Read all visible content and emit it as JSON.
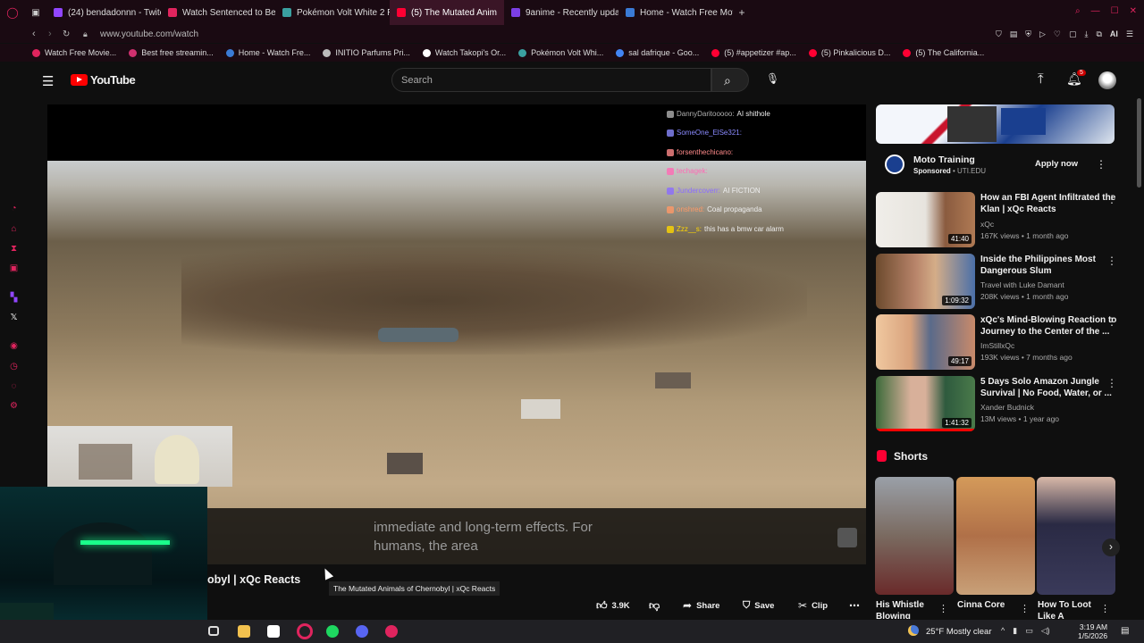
{
  "browser": {
    "tabs": [
      {
        "label": "(24) bendadonnn - Twitch",
        "color": "#9146ff",
        "active": false
      },
      {
        "label": "Watch Sentenced to Be a",
        "color": "#e0245e",
        "active": false
      },
      {
        "label": "Pokémon Volt White 2 Re",
        "color": "#3aa0a0",
        "active": false
      },
      {
        "label": "(5) The Mutated Anim",
        "color": "#ff0033",
        "active": true
      },
      {
        "label": "9anime - Recently update",
        "color": "#7b3fe4",
        "active": false
      },
      {
        "label": "Home - Watch Free Movie",
        "color": "#3a7bd5",
        "active": false
      }
    ],
    "new_tab_symbol": "+",
    "url": "www.youtube.com/watch",
    "bookmarks": [
      {
        "label": "Watch Free Movie...",
        "color": "#e0245e"
      },
      {
        "label": "Best free streamin...",
        "color": "#d0306f"
      },
      {
        "label": "Home - Watch Fre...",
        "color": "#3a7bd5"
      },
      {
        "label": "INITIO Parfums Pri...",
        "color": "#bbbbbb"
      },
      {
        "label": "Watch Takopi's Or...",
        "color": "#ffffff"
      },
      {
        "label": "Pokémon Volt Whi...",
        "color": "#3aa0a0"
      },
      {
        "label": "sal dafrique - Goo...",
        "color": "#4285f4"
      },
      {
        "label": "(5) #appetizer #ap...",
        "color": "#ff0033"
      },
      {
        "label": "(5) Pinkalicious D...",
        "color": "#ff0033"
      },
      {
        "label": "(5) The California...",
        "color": "#ff0033"
      }
    ]
  },
  "youtube": {
    "logo_text": "YouTube",
    "search_placeholder": "Search",
    "notification_count": "5"
  },
  "video": {
    "caption_line1": "immediate and long-term effects. For",
    "caption_line2": "humans, the area",
    "title_partial": "obyl | xQc Reacts",
    "tooltip": "The Mutated Animals of Chernobyl | xQc Reacts",
    "likes": "3.9K",
    "share_label": "Share",
    "save_label": "Save",
    "clip_label": "Clip"
  },
  "chat": [
    {
      "user": "DannyDaritooooo:",
      "msg": "AI shithole",
      "color": "#b0b0b0"
    },
    {
      "user": "SomeOne_ElSe321:",
      "msg": "",
      "color": "#8a8aff"
    },
    {
      "user": "forsenthechicano:",
      "msg": "",
      "color": "#ff8a8a"
    },
    {
      "user": "techagek:",
      "msg": "",
      "color": "#ff69b4"
    },
    {
      "user": "Jundercoverr:",
      "msg": "AI FICTION",
      "color": "#8a6bff"
    },
    {
      "user": "onshred:",
      "msg": "Coal propaganda",
      "color": "#ff9966"
    },
    {
      "user": "Zzz__s:",
      "msg": "this has a bmw car alarm",
      "color": "#ffd700"
    }
  ],
  "ad": {
    "title": "Moto Training",
    "sponsored": "Sponsored",
    "domain": "UTI.EDU",
    "cta": "Apply now"
  },
  "recommendations": [
    {
      "title1": "How an FBI Agent Infiltrated the",
      "title2": "Klan | xQc Reacts",
      "channel": "xQc",
      "meta": "167K views • 1 month ago",
      "duration": "41:40"
    },
    {
      "title1": "Inside the Philippines Most",
      "title2": "Dangerous Slum",
      "channel": "Travel with Luke Damant",
      "meta": "208K views • 1 month ago",
      "duration": "1:09:32"
    },
    {
      "title1": "xQc's Mind-Blowing Reaction to",
      "title2": "Journey to the Center of the ...",
      "channel": "ImStillxQc",
      "meta": "193K views • 7 months ago",
      "duration": "49:17"
    },
    {
      "title1": "5 Days Solo Amazon Jungle",
      "title2": "Survival | No Food, Water, or ...",
      "channel": "Xander Budnick",
      "meta": "13M views • 1 year ago",
      "duration": "1:41:32"
    }
  ],
  "shorts": {
    "heading": "Shorts",
    "items": [
      {
        "title": "His Whistle Blowing"
      },
      {
        "title": "Cinna Core"
      },
      {
        "title": "How To Loot Like A"
      }
    ]
  },
  "taskbar": {
    "weather_temp": "25°F",
    "weather_desc": "Mostly clear",
    "time": "3:19 AM",
    "date": "1/5/2026"
  }
}
